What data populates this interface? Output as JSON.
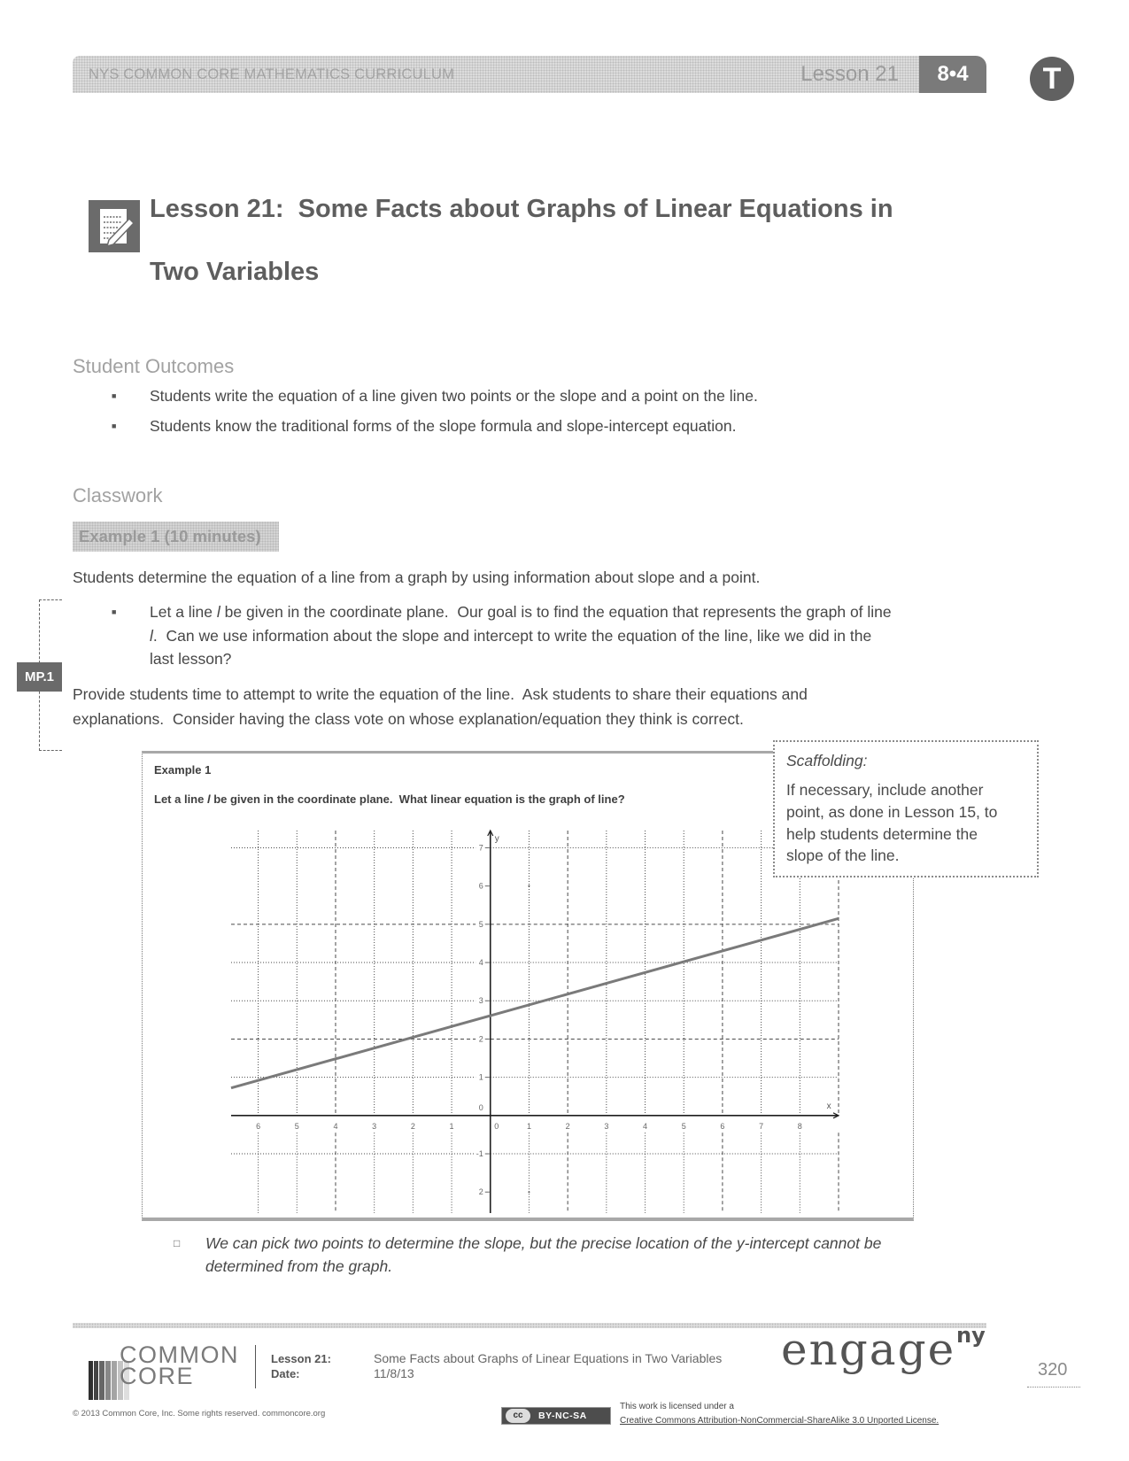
{
  "header": {
    "curriculum": "NYS COMMON CORE MATHEMATICS CURRICULUM",
    "lesson": "Lesson 21",
    "module_badge": "8•4",
    "teacher_badge": "T"
  },
  "title": {
    "icon": "lesson-notepad-icon",
    "line1": "Lesson 21:  Some Facts about Graphs of Linear Equations in",
    "line2": "Two Variables"
  },
  "student_outcomes": {
    "heading": "Student Outcomes",
    "bullet_glyph": "■",
    "items": [
      "Students write the equation of a line given two points or the slope and a point on the line.",
      "Students know the traditional forms of the slope formula and slope-intercept equation."
    ]
  },
  "classwork": {
    "heading": "Classwork",
    "example_heading": "Example 1 (10 minutes)",
    "intro": "Students determine the equation of a line from a graph by using information about slope and a point.",
    "bullet_glyph": "■",
    "bullet": {
      "line1_a": "Let a line ",
      "line1_var": "l",
      "line1_b": " be given in the coordinate plane.  Our goal is to find the equation that represents the graph of line",
      "line2_var": "l",
      "line2_b": ".  Can we use information about the slope and intercept to write the equation of the line, like we did in the",
      "line3": "last lesson?"
    },
    "mp_badge": "MP.1",
    "provide_lines": [
      "Provide students time to attempt to write the equation of the line.  Ask students to share their equations and",
      "explanations.  Consider having the class vote on whose explanation/equation they think is correct."
    ]
  },
  "example_box": {
    "title": "Example 1",
    "prompt_a": "Let a line ",
    "prompt_var": "l",
    "prompt_b": " be given in the coordinate plane.  What linear equation is the graph of line?"
  },
  "scaffolding": {
    "title": "Scaffolding:",
    "lines": [
      "If necessary, include another",
      "point, as done in Lesson 15, to",
      "help students determine the",
      "slope of the line."
    ]
  },
  "answer": {
    "bullet_glyph": "□",
    "lines": [
      "We can pick two points to determine the slope, but the precise location of the y-intercept cannot be",
      "determined from the graph."
    ]
  },
  "footer": {
    "logo_line1": "COMMON",
    "logo_line2": "CORE",
    "lesson_label": "Lesson 21:",
    "date_label": "Date:",
    "lesson_title": "Some Facts about Graphs of Linear Equations in Two Variables",
    "date_value": "11/8/13",
    "engage": "engage",
    "engage_sup": "ny",
    "page_number": "320",
    "copyright": "© 2013 Common Core, Inc. Some rights reserved. commoncore.org",
    "cc_badge": "BY-NC-SA",
    "cc_symbol": "cc",
    "license_line1": "This work is licensed under a",
    "license_link": "Creative Commons Attribution-NonCommercial-ShareAlike 3.0 Unported License."
  },
  "colors": {
    "header_bar": "#dcdcdc",
    "badge": "#7a7a7a",
    "teacher_badge": "#616161",
    "title_text": "#5e5e5e",
    "heading_text": "#a2a2a2",
    "body_text": "#474747",
    "graph_line": "#7a7a7a"
  },
  "chart_data": {
    "type": "line",
    "title": "",
    "xlabel": "x",
    "ylabel": "y",
    "xlim": [
      -6.7,
      9
    ],
    "ylim": [
      -2.55,
      7.45
    ],
    "grid": true,
    "x_ticks": [
      -6,
      -5,
      -4,
      -3,
      -2,
      -1,
      0,
      1,
      2,
      3,
      4,
      5,
      6,
      7,
      8
    ],
    "x_tick_labels": [
      "6",
      "5",
      "4",
      "3",
      "2",
      "1",
      "0",
      "1",
      "2",
      "3",
      "4",
      "5",
      "6",
      "7",
      "8"
    ],
    "y_ticks": [
      -2,
      -1,
      0,
      1,
      2,
      3,
      4,
      5,
      6,
      7
    ],
    "y_tick_labels": [
      "2",
      "-1",
      "0",
      "1",
      "2",
      "3",
      "4",
      "5",
      "6",
      "7"
    ],
    "grid_x": [
      -6,
      -5,
      -4,
      -3,
      -2,
      -1,
      1,
      2,
      3,
      4,
      5,
      6,
      7,
      8,
      9
    ],
    "grid_y": [
      -1,
      1,
      2,
      3,
      4,
      5,
      7
    ],
    "dashed_x": [
      -4,
      2,
      6,
      9
    ],
    "dashed_y": [
      2,
      5
    ],
    "dots": [
      [
        1,
        6
      ],
      [
        1,
        -2
      ]
    ],
    "series": [
      {
        "name": "line l",
        "points": [
          [
            -6.7,
            0.72
          ],
          [
            9,
            5.15
          ]
        ]
      }
    ]
  }
}
